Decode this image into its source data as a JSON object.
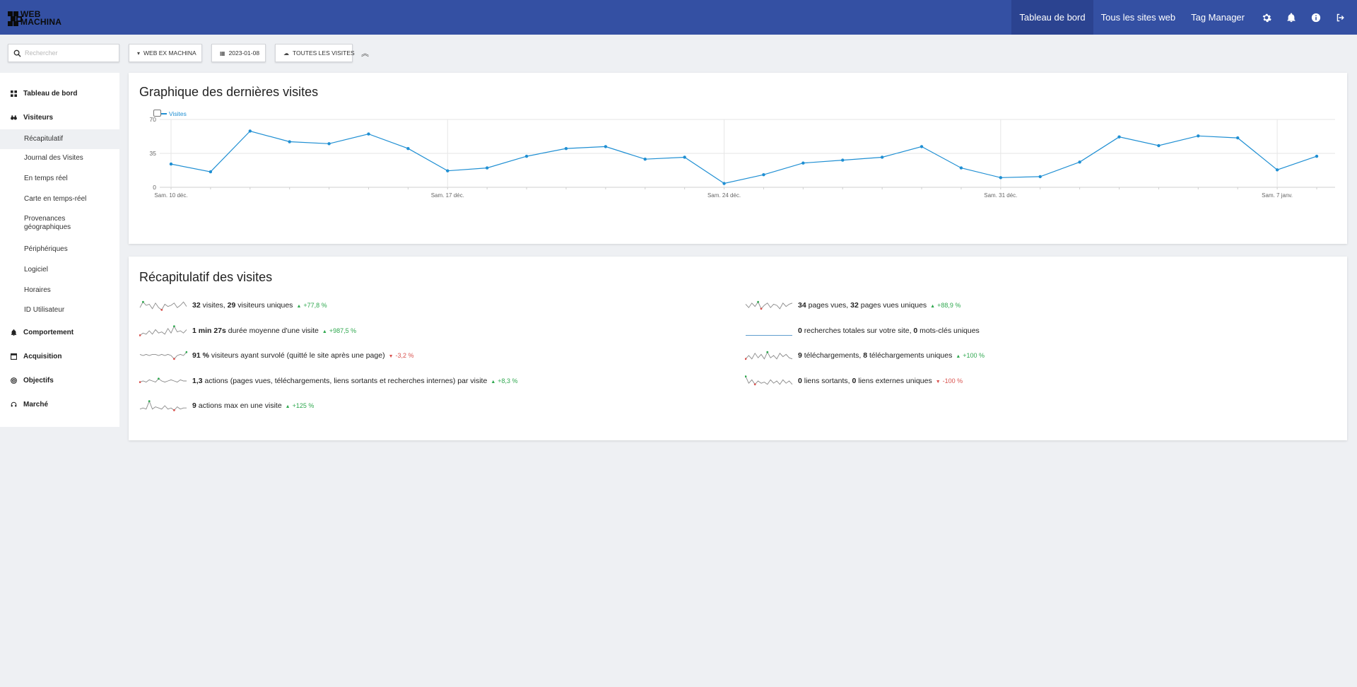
{
  "brand": {
    "line1": "WEB",
    "line2": "MACHINA"
  },
  "topnav": {
    "items": [
      "Tableau de bord",
      "Tous les sites web",
      "Tag Manager"
    ],
    "icons": [
      "gear-icon",
      "bell-icon",
      "info-icon",
      "logout-icon"
    ]
  },
  "filters": {
    "search_placeholder": "Rechercher",
    "site": "WEB EX MACHINA",
    "date": "2023-01-08",
    "segment": "TOUTES LES VISITES"
  },
  "sidebar": {
    "dashboard": "Tableau de bord",
    "visitors": "Visiteurs",
    "visitors_items": [
      "Récapitulatif",
      "Journal des Visites",
      "En temps réel",
      "Carte en temps-réel",
      "Provenances géographiques",
      "Périphériques",
      "Logiciel",
      "Horaires",
      "ID Utilisateur"
    ],
    "behaviour": "Comportement",
    "acquisition": "Acquisition",
    "goals": "Objectifs",
    "marketplace": "Marché"
  },
  "graph_card": {
    "title": "Graphique des dernières visites",
    "legend": "Visites"
  },
  "chart_data": {
    "type": "line",
    "title": "Graphique des dernières visites",
    "series": [
      {
        "name": "Visites",
        "values": [
          24,
          16,
          58,
          47,
          45,
          55,
          40,
          17,
          20,
          32,
          40,
          42,
          29,
          31,
          4,
          13,
          25,
          28,
          31,
          42,
          20,
          10,
          11,
          26,
          52,
          43,
          53,
          51,
          18,
          32
        ]
      }
    ],
    "x_start": "2022-12-10",
    "x_end": "2023-01-08",
    "x_tick_labels": [
      "Sam. 10 déc.",
      "Sam. 17 déc.",
      "Sam. 24 déc.",
      "Sam. 31 déc.",
      "Sam. 7 janv."
    ],
    "y_ticks": [
      0,
      35,
      70
    ],
    "ylim": [
      0,
      70
    ],
    "color": "#1f8fd3"
  },
  "summary_card": {
    "title": "Récapitulatif des visites",
    "left": [
      {
        "parts": [
          [
            "b",
            "32"
          ],
          [
            "t",
            " visites, "
          ],
          [
            "b",
            "29"
          ],
          [
            "t",
            " visiteurs uniques"
          ]
        ],
        "evolution": "+77,8 %",
        "trend": "up"
      },
      {
        "parts": [
          [
            "b",
            "1 min 27s"
          ],
          [
            "t",
            " durée moyenne d'une visite"
          ]
        ],
        "evolution": "+987,5 %",
        "trend": "up"
      },
      {
        "parts": [
          [
            "b",
            "91 %"
          ],
          [
            "t",
            " visiteurs ayant survolé (quitté le site après une page)"
          ]
        ],
        "evolution": "-3,2 %",
        "trend": "down"
      },
      {
        "parts": [
          [
            "b",
            "1,3"
          ],
          [
            "t",
            " actions (pages vues, téléchargements, liens sortants et recherches internes) par visite"
          ]
        ],
        "evolution": "+8,3 %",
        "trend": "up"
      },
      {
        "parts": [
          [
            "b",
            "9"
          ],
          [
            "t",
            " actions max en une visite"
          ]
        ],
        "evolution": "+125 %",
        "trend": "up"
      }
    ],
    "right": [
      {
        "parts": [
          [
            "b",
            "34"
          ],
          [
            "t",
            " pages vues, "
          ],
          [
            "b",
            "32"
          ],
          [
            "t",
            " pages vues uniques"
          ]
        ],
        "evolution": "+88,9 %",
        "trend": "up"
      },
      {
        "parts": [
          [
            "b",
            "0"
          ],
          [
            "t",
            " recherches totales sur votre site, "
          ],
          [
            "b",
            "0"
          ],
          [
            "t",
            " mots-clés uniques"
          ]
        ],
        "evolution": "",
        "trend": ""
      },
      {
        "parts": [
          [
            "b",
            "9"
          ],
          [
            "t",
            " téléchargements, "
          ],
          [
            "b",
            "8"
          ],
          [
            "t",
            " téléchargements uniques"
          ]
        ],
        "evolution": "+100 %",
        "trend": "up"
      },
      {
        "parts": [
          [
            "b",
            "0"
          ],
          [
            "t",
            " liens sortants, "
          ],
          [
            "b",
            "0"
          ],
          [
            "t",
            " liens externes uniques"
          ]
        ],
        "evolution": "-100 %",
        "trend": "down"
      }
    ]
  },
  "colors": {
    "topbar": "#3450a3",
    "topbar_active": "#2b4390",
    "line": "#1f8fd3",
    "positive": "#2fa84f",
    "negative": "#d9534f"
  }
}
